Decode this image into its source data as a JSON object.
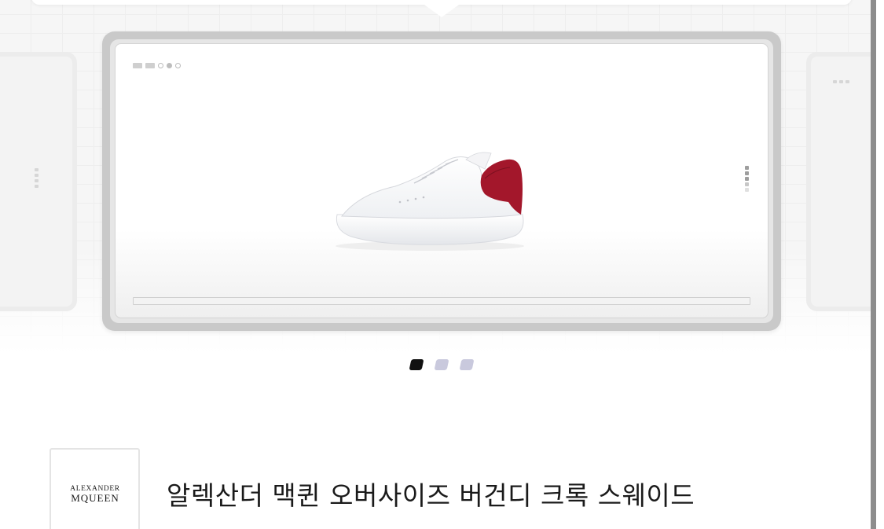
{
  "hero": {
    "carousel": {
      "slide_count": 3,
      "active_index": 0
    }
  },
  "brand": {
    "logo_line1": "ALEXANDER",
    "logo_line2": "MQUEEN"
  },
  "product": {
    "title": "알렉산더 맥퀸 오버사이즈 버건디 크록 스웨이드"
  },
  "icons": {
    "product_image": "sneaker-image",
    "brand_logo": "alexander-mcqueen-logo"
  },
  "colors": {
    "accent_burgundy": "#a3172b",
    "pager_active": "#111111",
    "pager_inactive": "#c9c9dd"
  }
}
